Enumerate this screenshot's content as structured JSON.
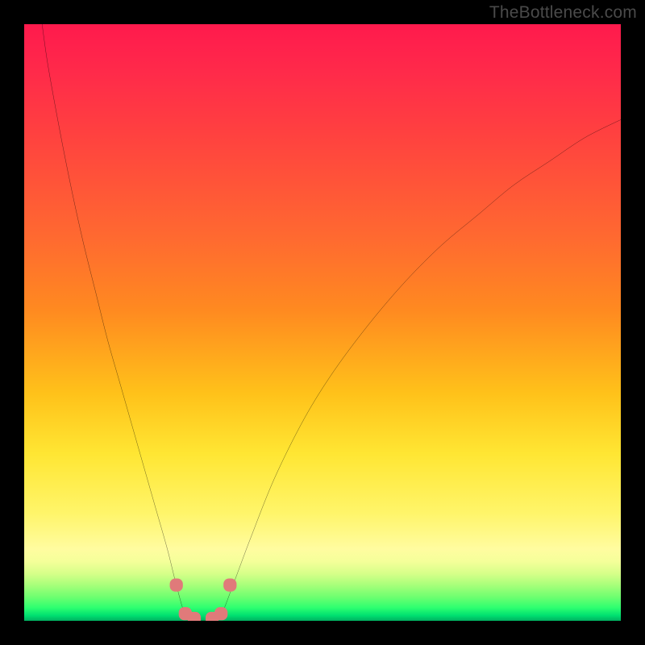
{
  "watermark": "TheBottleneck.com",
  "chart_data": {
    "type": "line",
    "title": "",
    "xlabel": "",
    "ylabel": "",
    "xlim": [
      0,
      100
    ],
    "ylim": [
      0,
      100
    ],
    "grid": false,
    "legend": false,
    "annotations": [],
    "background_gradient": {
      "top_color": "#ff1a4d",
      "mid_color": "#ffe633",
      "bottom_color": "#00b060"
    },
    "series": [
      {
        "name": "left-branch",
        "x": [
          3,
          4,
          6,
          8,
          10,
          12,
          14,
          16,
          18,
          20,
          22,
          24,
          25.5,
          27
        ],
        "y": [
          100,
          93,
          82,
          72,
          63,
          55,
          47,
          40,
          33,
          26,
          19,
          12,
          6,
          1
        ]
      },
      {
        "name": "right-branch",
        "x": [
          33,
          35,
          38,
          42,
          47,
          52,
          58,
          64,
          70,
          76,
          82,
          88,
          94,
          100
        ],
        "y": [
          1,
          6,
          14,
          24,
          34,
          42,
          50,
          57,
          63,
          68,
          73,
          77,
          81,
          84
        ]
      },
      {
        "name": "trough",
        "x": [
          27,
          28.5,
          30,
          31.5,
          33
        ],
        "y": [
          1,
          0.2,
          0,
          0.2,
          1
        ]
      }
    ],
    "markers": [
      {
        "x": 25.5,
        "y": 6
      },
      {
        "x": 27.0,
        "y": 1.2
      },
      {
        "x": 28.5,
        "y": 0.4
      },
      {
        "x": 31.5,
        "y": 0.4
      },
      {
        "x": 33.0,
        "y": 1.2
      },
      {
        "x": 34.5,
        "y": 6
      }
    ],
    "marker_style": {
      "color": "#e07a7a",
      "shape": "rounded-square",
      "size": 2.2
    },
    "curve_style": {
      "color": "#000000",
      "width": 0.25
    }
  }
}
